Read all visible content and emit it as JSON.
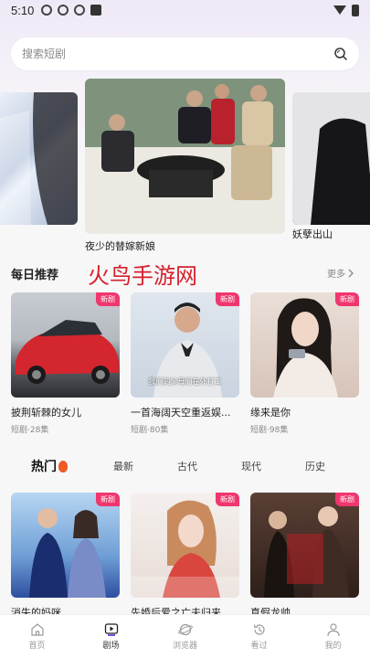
{
  "status": {
    "time": "5:10"
  },
  "search": {
    "placeholder": "搜索短剧"
  },
  "carousel": {
    "main_caption": "夜少的替嫁新娘",
    "right_caption": "妖孽出山"
  },
  "daily": {
    "title": "每日推荐",
    "watermark": "火鸟手游网",
    "more_label": "更多",
    "items": [
      {
        "title": "披荆斩棘的女儿",
        "meta": "短剧·28集",
        "badge": "新剧"
      },
      {
        "title": "一首海阔天空重返娱...",
        "meta": "短剧·80集",
        "badge": "新剧",
        "subtitle": "我们的父母们在外打工"
      },
      {
        "title": "缘来是你",
        "meta": "短剧·98集",
        "badge": "新剧"
      }
    ]
  },
  "tabs": [
    "热门",
    "最新",
    "古代",
    "现代",
    "历史"
  ],
  "hot": {
    "items": [
      {
        "title": "消失的妈咪",
        "badge": "新剧"
      },
      {
        "title": "先婚后爱之亡夫归来",
        "badge": "新剧"
      },
      {
        "title": "真假龙帅",
        "badge": "新剧"
      }
    ]
  },
  "nav": [
    {
      "label": "首页",
      "icon": "home-icon"
    },
    {
      "label": "剧场",
      "icon": "theater-icon"
    },
    {
      "label": "浏览器",
      "icon": "browser-icon"
    },
    {
      "label": "看过",
      "icon": "history-icon"
    },
    {
      "label": "我的",
      "icon": "profile-icon"
    }
  ],
  "colors": {
    "accent": "#f0366e",
    "watermark": "#d6212c"
  }
}
